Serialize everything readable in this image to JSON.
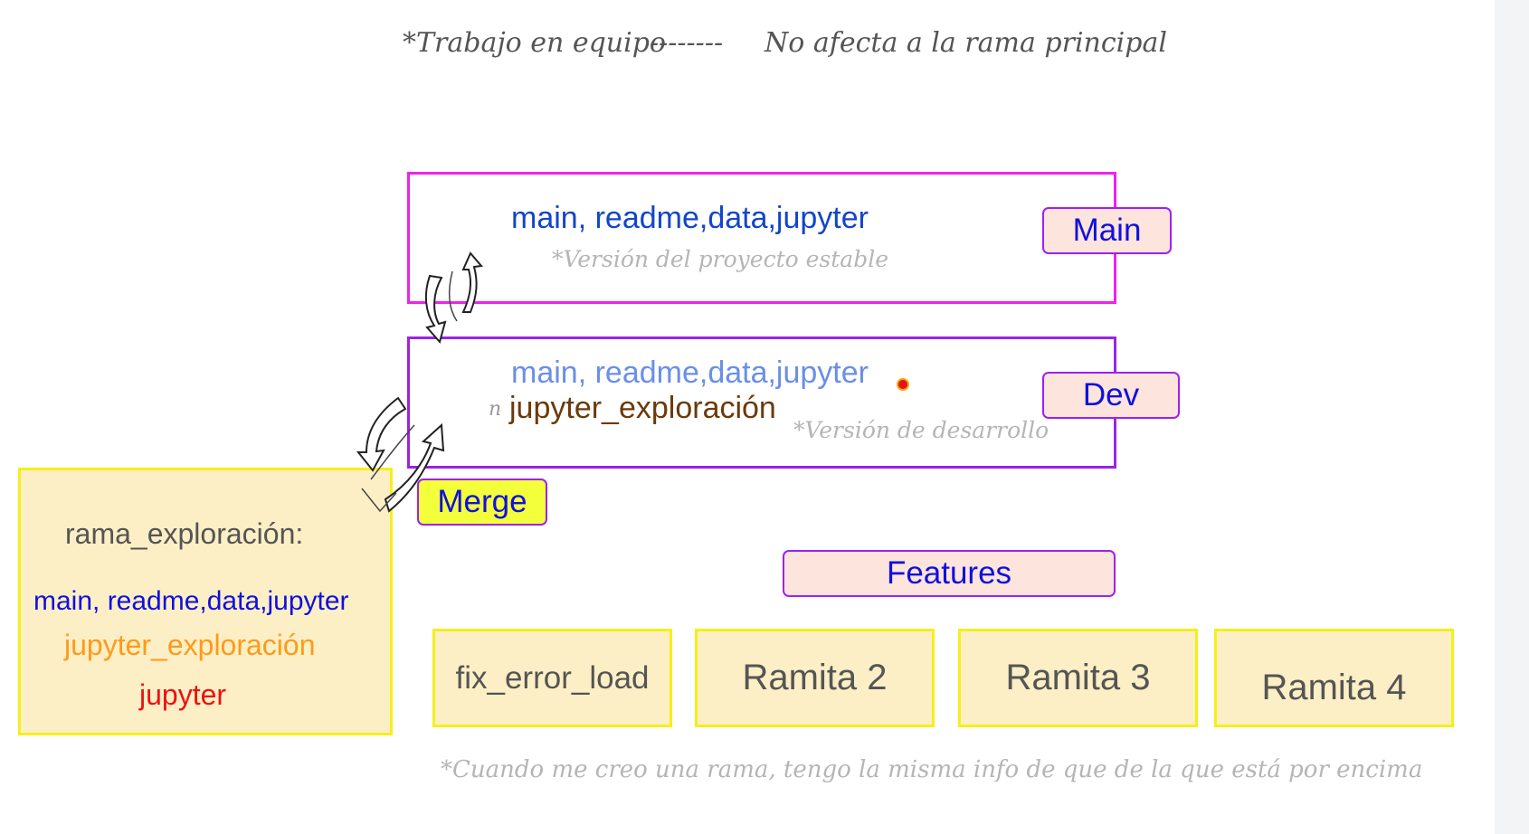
{
  "header": {
    "left": "*Trabajo en equipo",
    "dashes": "--------",
    "right": "No afecta a la rama principal"
  },
  "main_box": {
    "files": "main, readme,data,jupyter",
    "note": "*Versión del proyecto estable",
    "tag": "Main"
  },
  "dev_box": {
    "files": "main, readme,data,jupyter",
    "marker": "n",
    "new_file": "jupyter_exploración",
    "note": "*Versión de desarrollo",
    "tag": "Dev"
  },
  "merge_tag": "Merge",
  "exploration_box": {
    "title": "rama_exploración:",
    "files": "main, readme,data,jupyter",
    "file_2": "jupyter_exploración",
    "file_3": "jupyter"
  },
  "features": {
    "tag": "Features",
    "branches": [
      "fix_error_load",
      "Ramita 2",
      "Ramita 3",
      "Ramita 4"
    ]
  },
  "footer_note": "*Cuando me creo una rama, tengo la misma info de que de la que está por encima",
  "colors": {
    "main_border": "#ee22ee",
    "dev_border": "#9a22e6",
    "tag_fill": "#fde4dc",
    "tag_border": "#a020f0",
    "tag_text": "#1010dd",
    "merge_fill": "#f3ff3a",
    "yellow_border": "#f5ef1a",
    "yellow_fill": "#fdefc5",
    "blue_text": "#1346c8",
    "light_blue_text": "#6a8fe6",
    "brown_text": "#6b3a0a",
    "orange_text": "#ff9a1a",
    "red_text": "#ee1111",
    "note_gray": "#b5b5b5"
  }
}
